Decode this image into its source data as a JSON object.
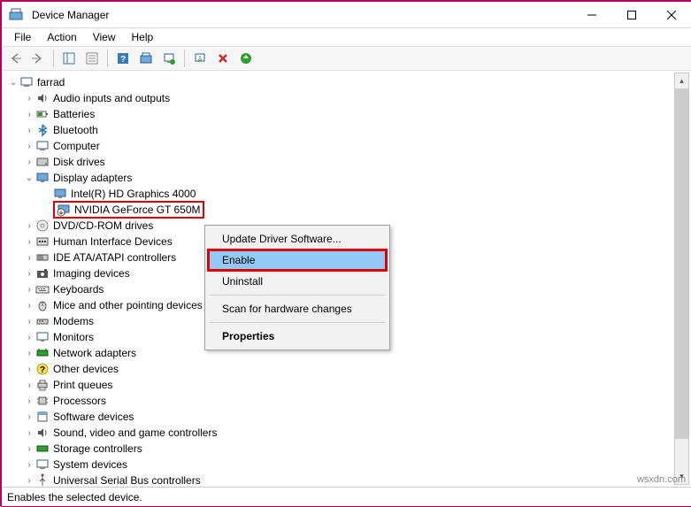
{
  "window": {
    "title": "Device Manager"
  },
  "menubar": {
    "items": [
      "File",
      "Action",
      "View",
      "Help"
    ]
  },
  "tree": {
    "root": "farrad",
    "nodes": [
      {
        "label": "Audio inputs and outputs",
        "expanded": false
      },
      {
        "label": "Batteries",
        "expanded": false
      },
      {
        "label": "Bluetooth",
        "expanded": false
      },
      {
        "label": "Computer",
        "expanded": false
      },
      {
        "label": "Disk drives",
        "expanded": false
      },
      {
        "label": "Display adapters",
        "expanded": true,
        "children": [
          {
            "label": "Intel(R) HD Graphics 4000",
            "selected": false
          },
          {
            "label": "NVIDIA GeForce GT 650M",
            "selected": true
          }
        ]
      },
      {
        "label": "DVD/CD-ROM drives",
        "expanded": false
      },
      {
        "label": "Human Interface Devices",
        "expanded": false
      },
      {
        "label": "IDE ATA/ATAPI controllers",
        "expanded": false
      },
      {
        "label": "Imaging devices",
        "expanded": false
      },
      {
        "label": "Keyboards",
        "expanded": false
      },
      {
        "label": "Mice and other pointing devices",
        "expanded": false
      },
      {
        "label": "Modems",
        "expanded": false
      },
      {
        "label": "Monitors",
        "expanded": false
      },
      {
        "label": "Network adapters",
        "expanded": false
      },
      {
        "label": "Other devices",
        "expanded": false
      },
      {
        "label": "Print queues",
        "expanded": false
      },
      {
        "label": "Processors",
        "expanded": false
      },
      {
        "label": "Software devices",
        "expanded": false
      },
      {
        "label": "Sound, video and game controllers",
        "expanded": false
      },
      {
        "label": "Storage controllers",
        "expanded": false
      },
      {
        "label": "System devices",
        "expanded": false
      },
      {
        "label": "Universal Serial Bus controllers",
        "expanded": false
      }
    ]
  },
  "context_menu": {
    "items": [
      {
        "label": "Update Driver Software...",
        "type": "item"
      },
      {
        "label": "Enable",
        "type": "item",
        "highlighted": true
      },
      {
        "label": "Uninstall",
        "type": "item"
      },
      {
        "type": "separator"
      },
      {
        "label": "Scan for hardware changes",
        "type": "item"
      },
      {
        "type": "separator"
      },
      {
        "label": "Properties",
        "type": "item",
        "bold": true
      }
    ]
  },
  "statusbar": {
    "text": "Enables the selected device."
  },
  "watermark": "wsxdn.com"
}
